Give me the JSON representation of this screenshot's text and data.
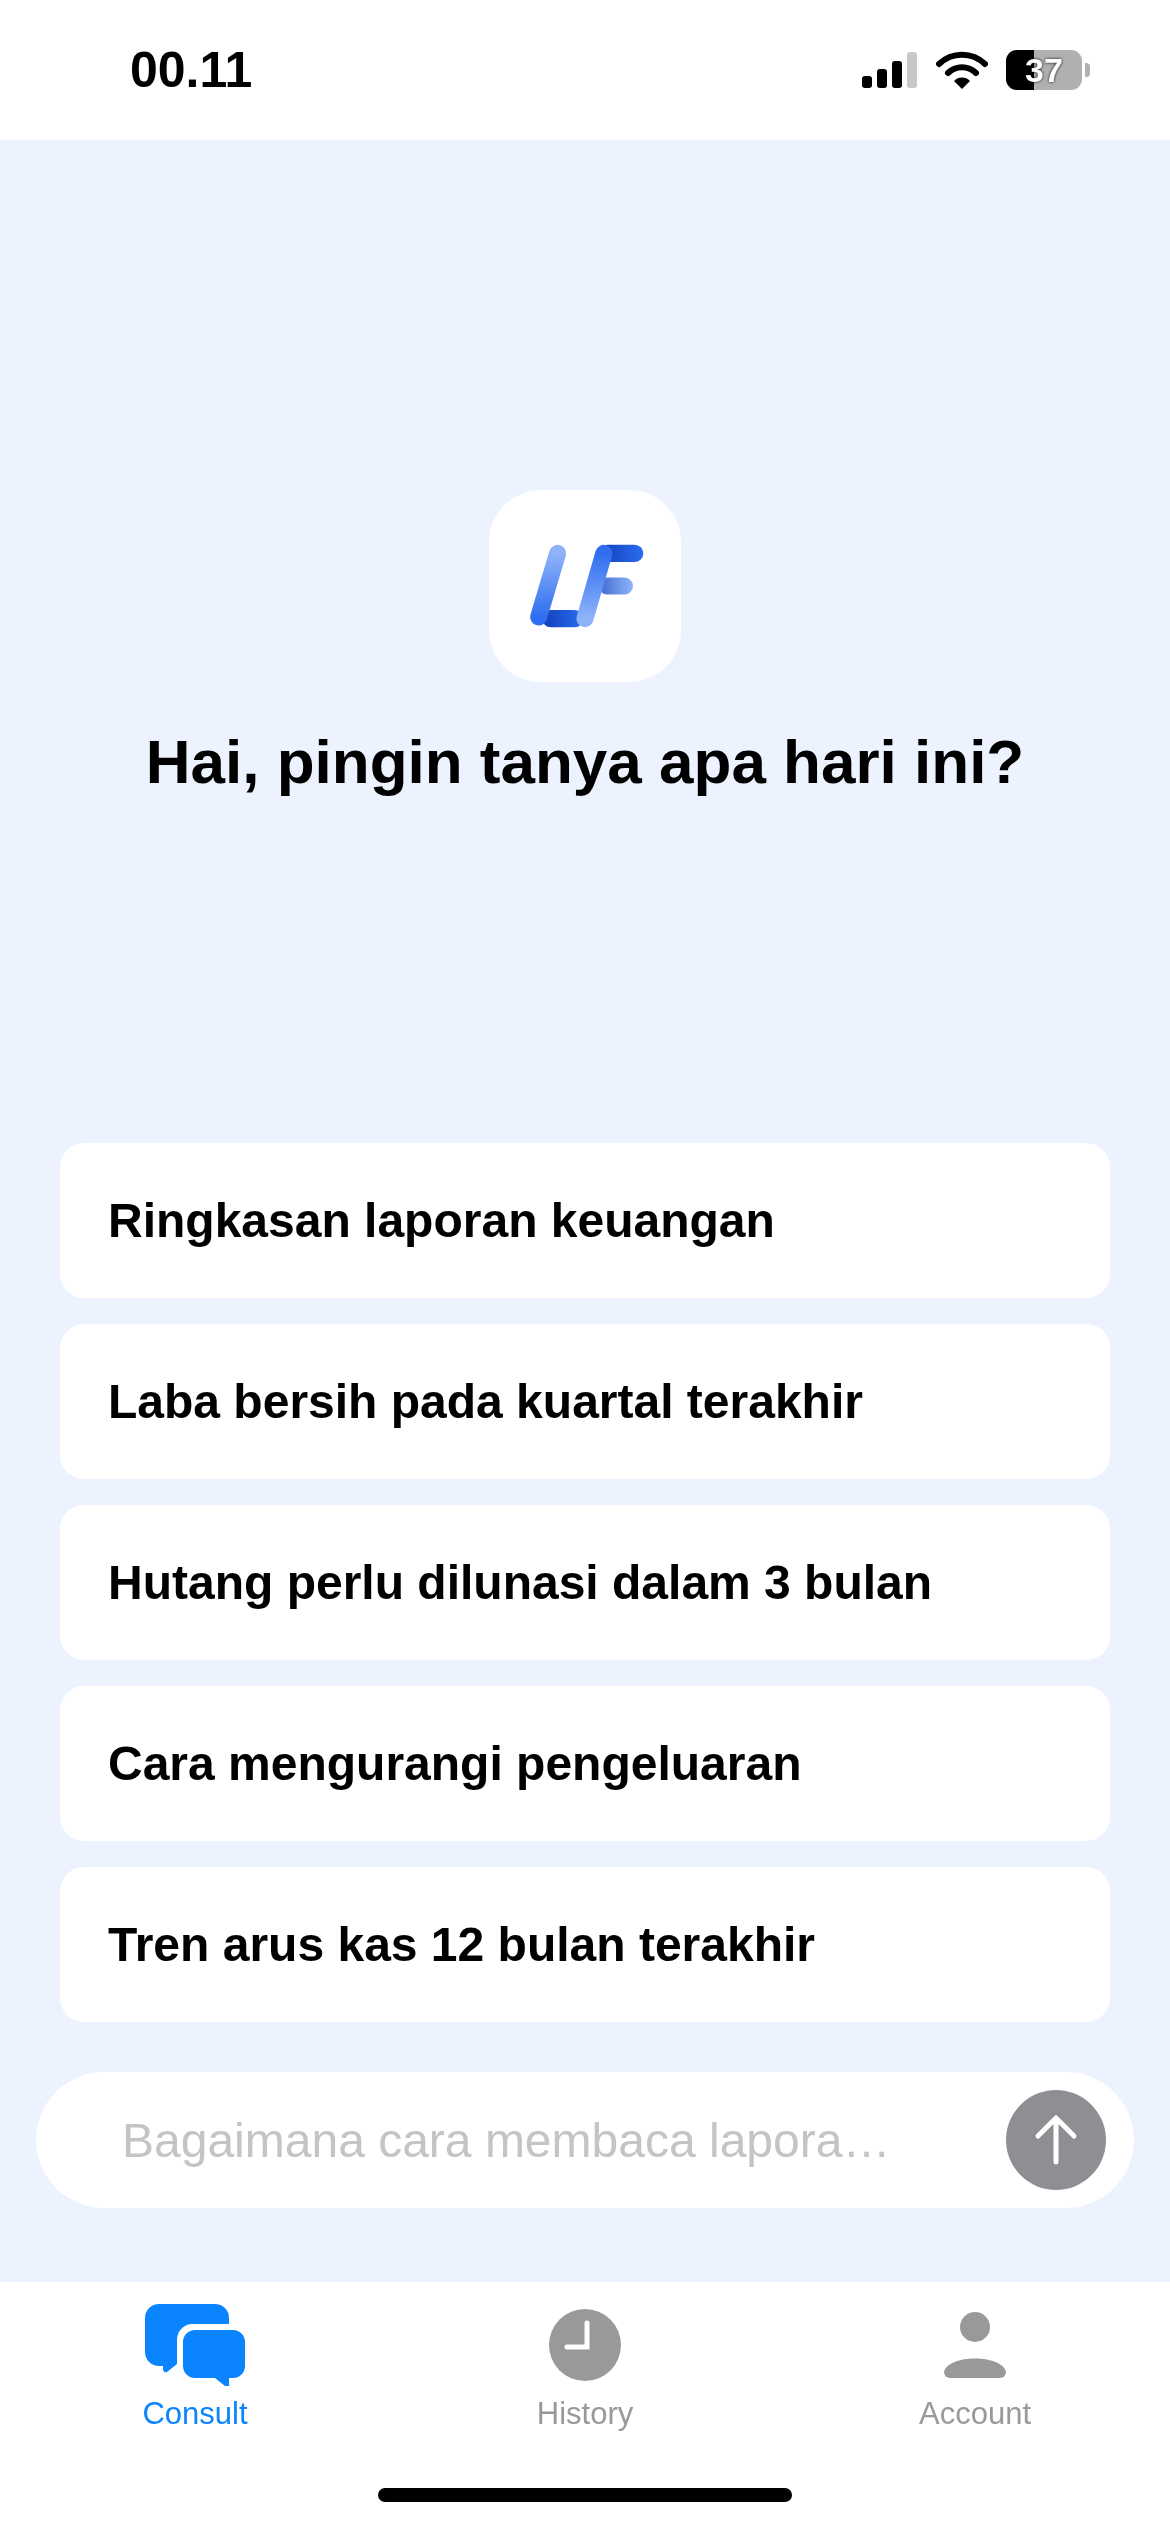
{
  "status_bar": {
    "time": "00.11",
    "battery": "37"
  },
  "greeting": "Hai, pingin tanya apa hari ini?",
  "suggestions": [
    "Ringkasan laporan keuangan",
    "Laba bersih pada kuartal terakhir",
    "Hutang perlu dilunasi dalam 3 bulan",
    "Cara mengurangi pengeluaran",
    "Tren arus kas 12 bulan terakhir"
  ],
  "input": {
    "placeholder": "Bagaimana cara membaca lapora…"
  },
  "tabs": [
    {
      "label": "Consult",
      "kind": "chat",
      "selected": true
    },
    {
      "label": "History",
      "kind": "clock",
      "selected": false
    },
    {
      "label": "Account",
      "kind": "person",
      "selected": false
    }
  ]
}
